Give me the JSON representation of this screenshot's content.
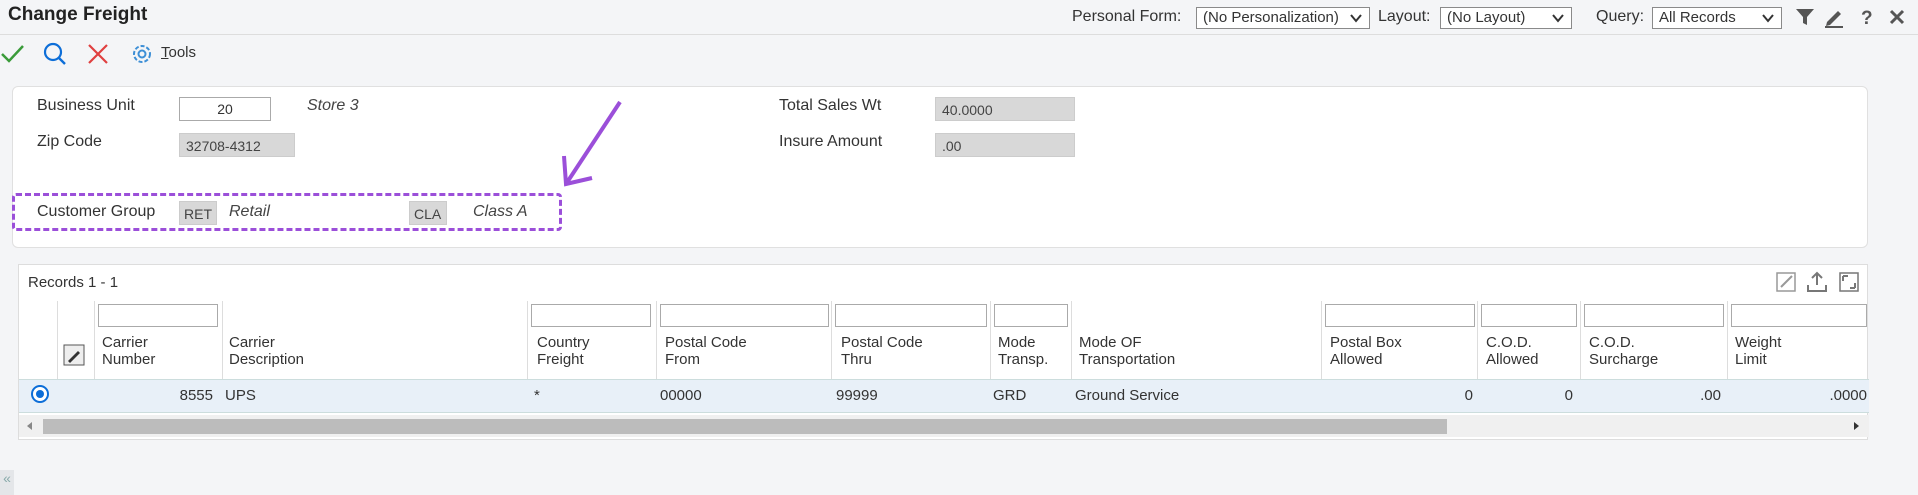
{
  "header": {
    "title": "Change Freight",
    "personal_form_label": "Personal Form:",
    "personal_form_value": "(No Personalization)",
    "layout_label": "Layout:",
    "layout_value": "(No Layout)",
    "query_label": "Query:",
    "query_value": "All Records",
    "caret": "⌄"
  },
  "toolbar": {
    "tools_label_prefix": "T",
    "tools_label_rest": "ools"
  },
  "form": {
    "business_unit_label": "Business Unit",
    "business_unit_value": "20",
    "business_unit_desc": "Store 3",
    "zip_code_label": "Zip Code",
    "zip_code_value": "32708-4312",
    "total_sales_wt_label": "Total Sales Wt",
    "total_sales_wt_value": "40.0000",
    "insure_amount_label": "Insure Amount",
    "insure_amount_value": ".00",
    "customer_group_label": "Customer Group",
    "customer_group_code1": "RET",
    "customer_group_desc1": "Retail",
    "customer_group_code2": "CLA",
    "customer_group_desc2": "Class A"
  },
  "grid": {
    "records_label": "Records 1 - 1",
    "columns": [
      {
        "line1": "Carrier",
        "line2": "Number"
      },
      {
        "line1": "Carrier",
        "line2": "Description"
      },
      {
        "line1": "Country",
        "line2": "Freight"
      },
      {
        "line1": "Postal Code",
        "line2": "From"
      },
      {
        "line1": "Postal Code",
        "line2": "Thru"
      },
      {
        "line1": "Mode",
        "line2": "Transp."
      },
      {
        "line1": "Mode OF",
        "line2": "Transportation"
      },
      {
        "line1": "Postal Box",
        "line2": "Allowed"
      },
      {
        "line1": "C.O.D.",
        "line2": "Allowed"
      },
      {
        "line1": "C.O.D.",
        "line2": "Surcharge"
      },
      {
        "line1": "Weight",
        "line2": "Limit"
      }
    ],
    "row": {
      "carrier_number": "8555",
      "carrier_description": "UPS",
      "country_freight": "*",
      "postal_from": "00000",
      "postal_thru": "99999",
      "mode_transp": "GRD",
      "mode_of_transportation": "Ground Service",
      "postal_box_allowed": "0",
      "cod_allowed": "0",
      "cod_surcharge": ".00",
      "weight_limit": ".0000"
    }
  },
  "colors": {
    "accent": "#0d6ed8",
    "annotation": "#9b4fd9",
    "ok_green": "#3a9b3a",
    "cancel_red": "#e04040"
  },
  "misc": {
    "collapse_glyph": "«"
  }
}
